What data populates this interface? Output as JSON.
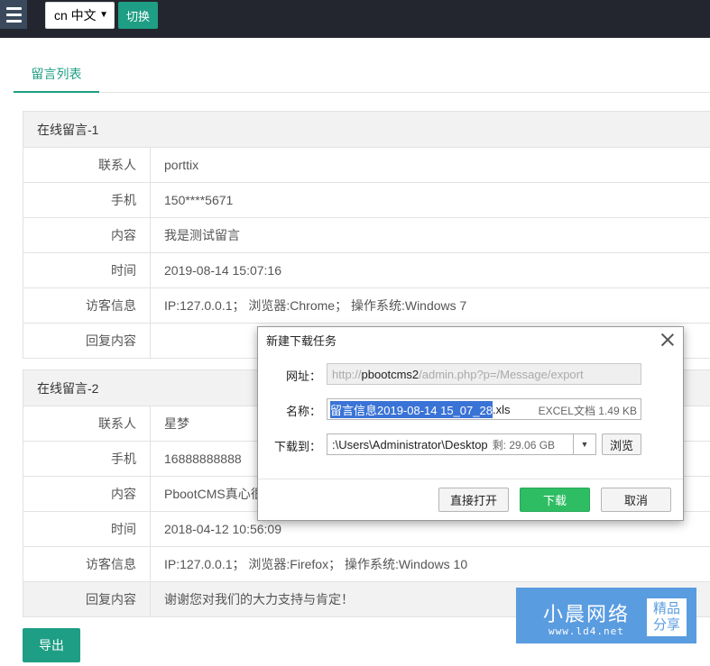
{
  "topbar": {
    "lang_value": "cn 中文",
    "switch_label": "切换"
  },
  "tabs": {
    "active_label": "留言列表"
  },
  "messages": [
    {
      "title": "在线留言-1",
      "rows": [
        {
          "label": "联系人",
          "value": "porttix"
        },
        {
          "label": "手机",
          "value": "150****5671"
        },
        {
          "label": "内容",
          "value": "我是测试留言"
        },
        {
          "label": "时间",
          "value": "2019-08-14 15:07:16"
        },
        {
          "label": "访客信息",
          "value": "IP:127.0.0.1； 浏览器:Chrome； 操作系统:Windows 7"
        },
        {
          "label": "回复内容",
          "value": ""
        }
      ]
    },
    {
      "title": "在线留言-2",
      "rows": [
        {
          "label": "联系人",
          "value": "星梦"
        },
        {
          "label": "手机",
          "value": "16888888888"
        },
        {
          "label": "内容",
          "value": "PbootCMS真心很"
        },
        {
          "label": "时间",
          "value": "2018-04-12 10:56:09"
        },
        {
          "label": "访客信息",
          "value": "IP:127.0.0.1； 浏览器:Firefox； 操作系统:Windows 10"
        },
        {
          "label": "回复内容",
          "value": "谢谢您对我们的大力支持与肯定！"
        }
      ]
    }
  ],
  "export_label": "导出",
  "dialog": {
    "title": "新建下载任务",
    "url_label": "网址：",
    "url_prefix": "http://",
    "url_host": "pbootcms2",
    "url_path": "/admin.php?p=/Message/export",
    "name_label": "名称：",
    "name_selected": "留言信息2019-08-14 15_07_28",
    "name_ext": ".xls",
    "file_type": "EXCEL文档 1.49 KB",
    "path_label": "下载到：",
    "path_value": ":\\Users\\Administrator\\Desktop",
    "path_space": "剩: 29.06 GB",
    "browse_label": "浏览",
    "open_label": "直接打开",
    "download_label": "下载",
    "cancel_label": "取消"
  },
  "watermark": {
    "name": "小晨网络",
    "url": "www.ld4.net",
    "badge_line1": "精品",
    "badge_line2": "分享"
  },
  "colors": {
    "topbar_bg": "#23262e",
    "accent_green": "#1e9e84",
    "download_green": "#2ebd63",
    "watermark_blue": "#5a9ce0"
  },
  "icons": {
    "menu": "hamburger-icon",
    "dropdown": "caret-down-icon",
    "close": "close-icon"
  }
}
